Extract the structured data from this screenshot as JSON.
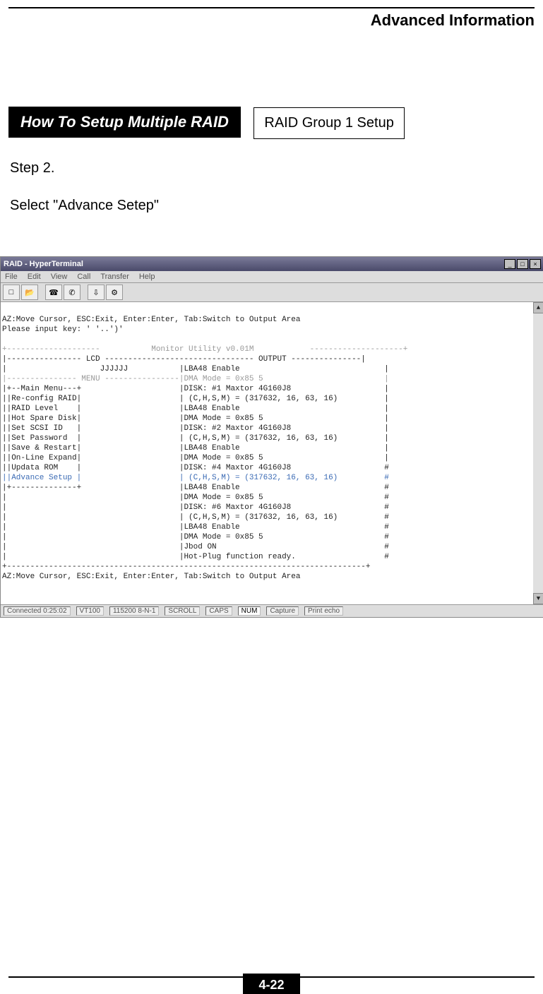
{
  "header": {
    "title": "Advanced Information"
  },
  "section": {
    "heading": "How To Setup Multiple RAID",
    "sub_box": "RAID Group 1 Setup",
    "step_label": "Step 2.",
    "instruction": "Select \"Advance Setep\""
  },
  "hyperterminal": {
    "title": "RAID - HyperTerminal",
    "menu": [
      "File",
      "Edit",
      "View",
      "Call",
      "Transfer",
      "Help"
    ],
    "toolbar_icons": [
      "new-icon",
      "open-icon",
      "connect-icon",
      "hangup-icon",
      "send-icon",
      "props-icon"
    ],
    "statusbar": {
      "connected": "Connected 0:25:02",
      "emulation": "VT100",
      "settings": "115200 8-N-1",
      "scroll": "SCROLL",
      "caps": "CAPS",
      "num": "NUM",
      "capture": "Capture",
      "printecho": "Print echo"
    },
    "terminal": {
      "top_help": "AZ:Move Cursor, ESC:Exit, Enter:Enter, Tab:Switch to Output Area",
      "prompt": "Please input key: ' '..')'",
      "monitor_line": "+--------------------           Monitor Utility v0.01M            --------------------+",
      "col_header": "|---------------- LCD -------------------------------- OUTPUT ---------------|",
      "lcd_content": "|                    JJJJJJ           |LBA48 Enable                               |",
      "menu_header": "|--------------- MENU ----------------|DMA Mode = 0x85 5                          |",
      "menu_items": [
        "|+--Main Menu---+                     |DISK: #1 Maxtor 4G160J8                    |",
        "||Re-config RAID|                     | (C,H,S,M) = (317632, 16, 63, 16)          |",
        "||RAID Level    |                     |LBA48 Enable                               |",
        "||Hot Spare Disk|                     |DMA Mode = 0x85 5                          |",
        "||Set SCSI ID   |                     |DISK: #2 Maxtor 4G160J8                    |",
        "||Set Password  |                     | (C,H,S,M) = (317632, 16, 63, 16)          |",
        "||Save & Restart|                     |LBA48 Enable                               |",
        "||On-Line Expand|                     |DMA Mode = 0x85 5                          |",
        "||Updata ROM    |                     |DISK: #4 Maxtor 4G160J8                    #"
      ],
      "advance_line": "||Advance Setup |                     | (C,H,S,M) = (317632, 16, 63, 16)          #",
      "menu_footer": "|+--------------+                     |LBA48 Enable                               #",
      "output_rest": [
        "|                                     |DMA Mode = 0x85 5                          #",
        "|                                     |DISK: #6 Maxtor 4G160J8                    #",
        "|                                     | (C,H,S,M) = (317632, 16, 63, 16)          #",
        "|                                     |LBA48 Enable                               #",
        "|                                     |DMA Mode = 0x85 5                          #",
        "|                                     |Jbod ON                                    #",
        "|                                     |Hot-Plug function ready.                   #"
      ],
      "bottom_border": "+-----------------------------------------------------------------------------+",
      "bottom_help": "AZ:Move Cursor, ESC:Exit, Enter:Enter, Tab:Switch to Output Area"
    }
  },
  "footer": {
    "page_number": "4-22"
  }
}
